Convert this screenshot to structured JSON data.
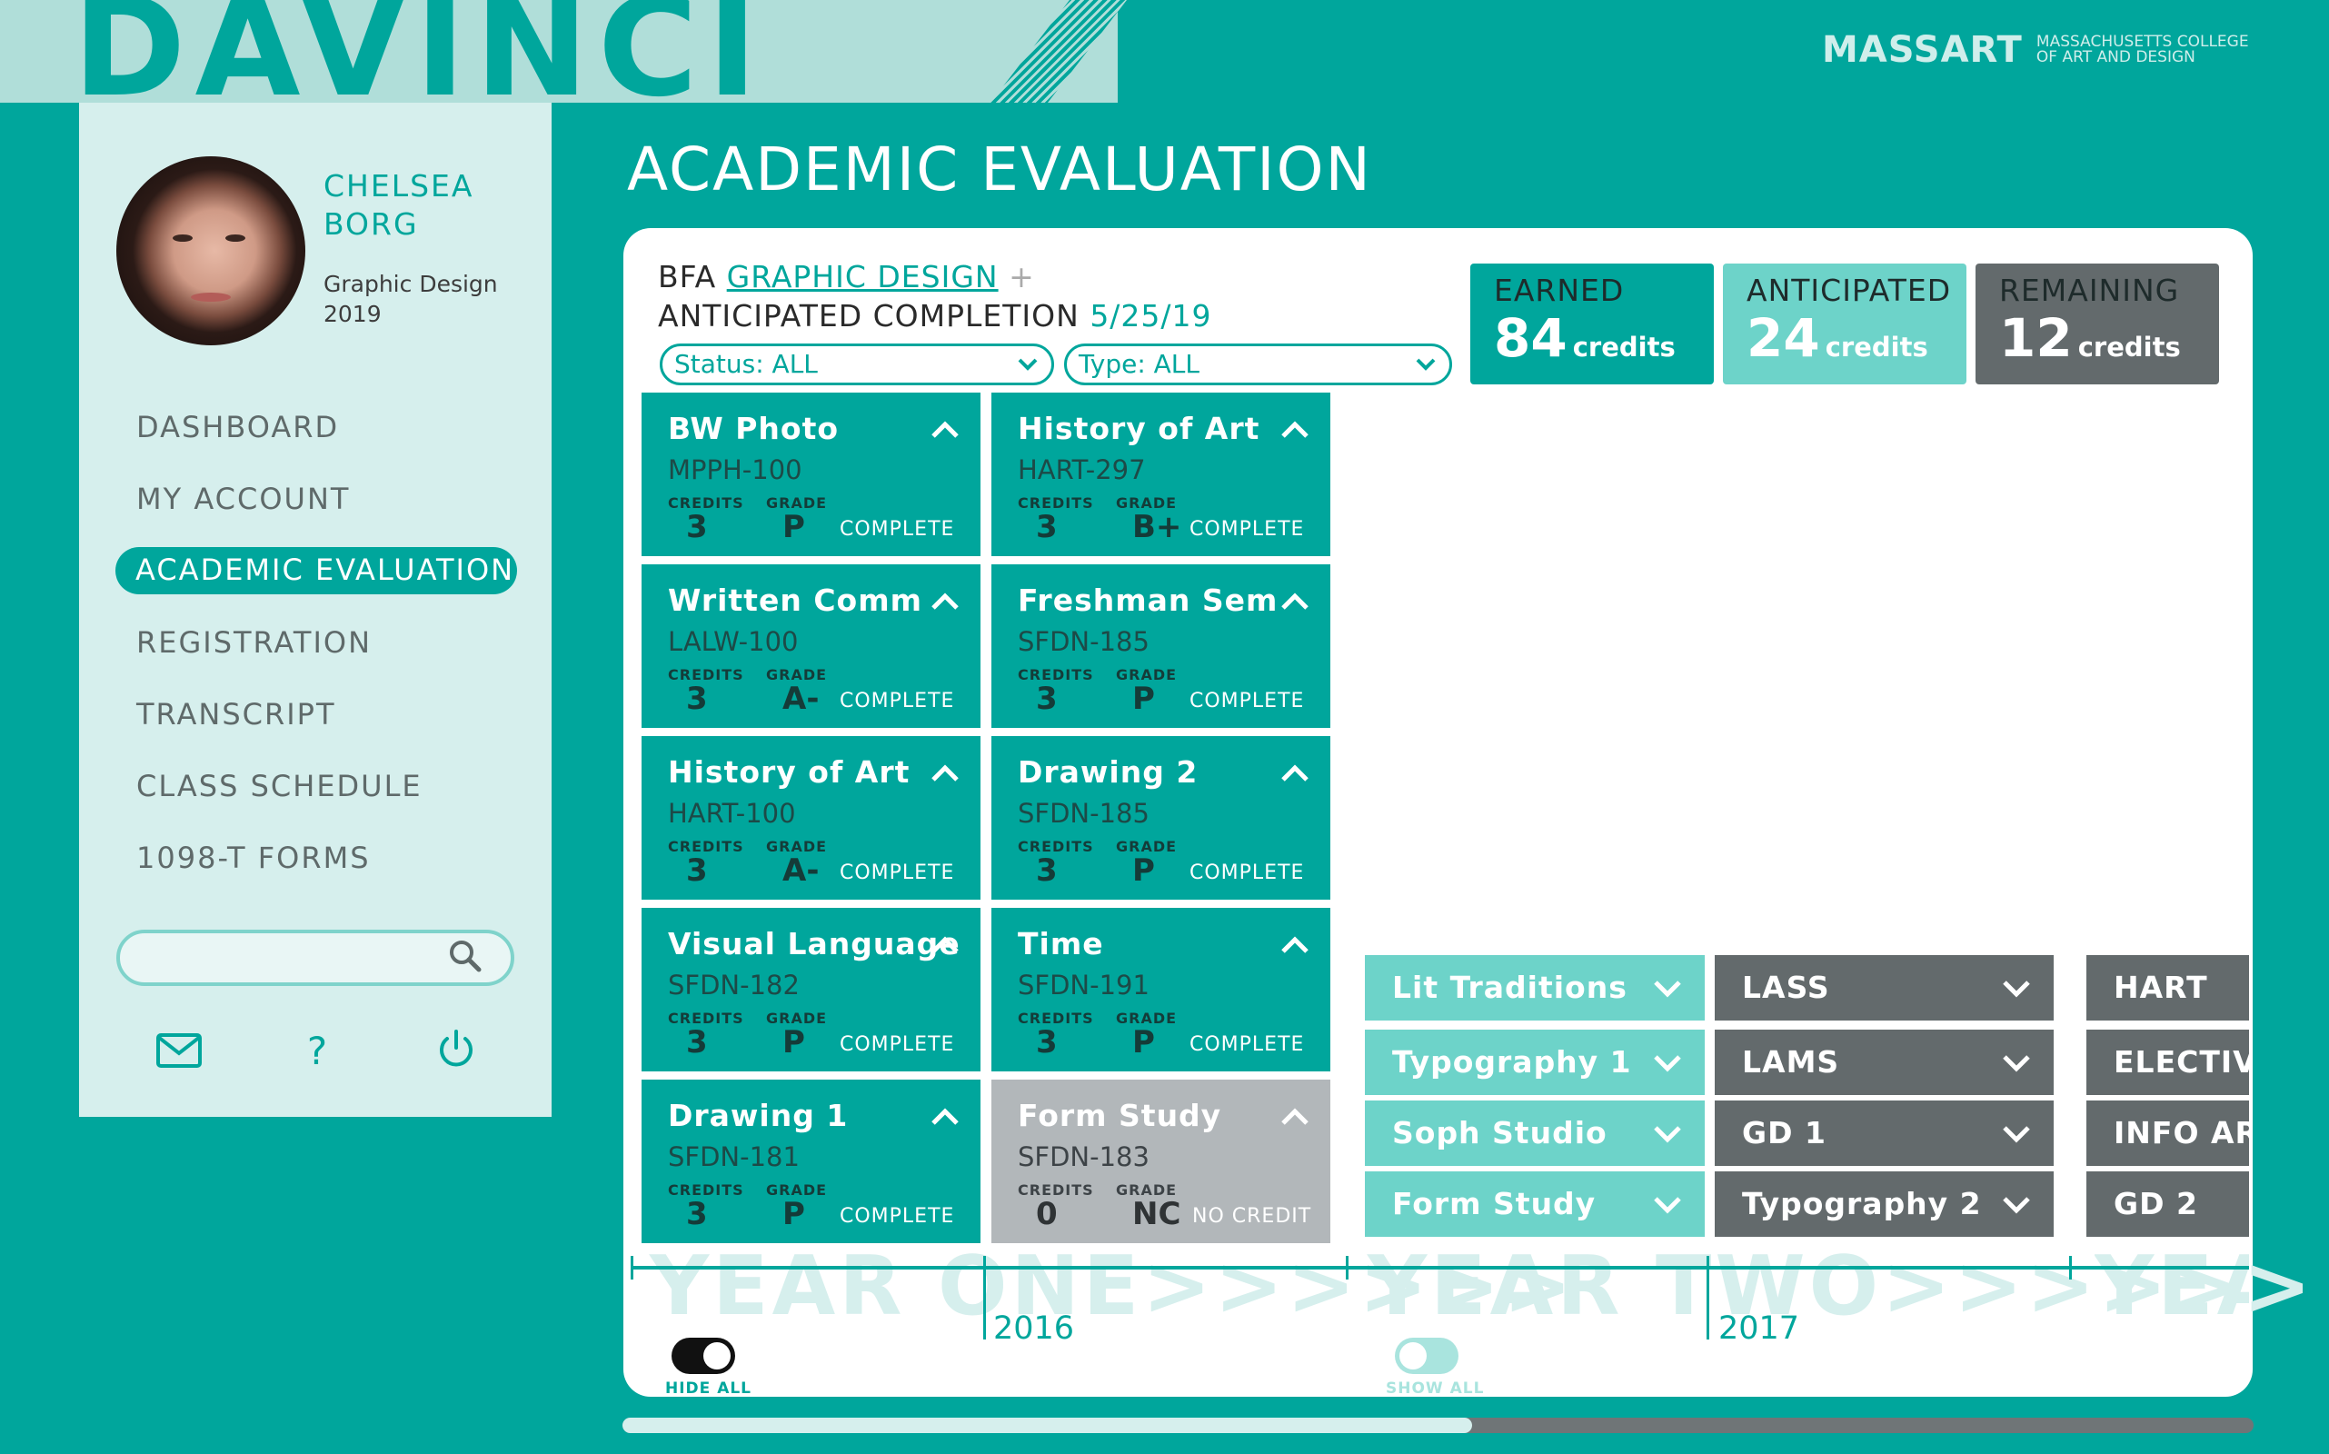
{
  "app": {
    "logo": "DAVINCI",
    "college_logo": "MASSART",
    "college_name_line1": "MASSACHUSETTS COLLEGE",
    "college_name_line2": "OF ART AND DESIGN"
  },
  "user": {
    "first": "CHELSEA",
    "last": "BORG",
    "program": "Graphic Design",
    "year": "2019"
  },
  "nav": {
    "items": [
      "DASHBOARD",
      "MY ACCOUNT",
      "ACADEMIC EVALUATION",
      "REGISTRATION",
      "TRANSCRIPT",
      "CLASS SCHEDULE",
      "1098-T FORMS"
    ],
    "active": "ACADEMIC EVALUATION"
  },
  "icons": {
    "mail": "mail-icon",
    "help": "help-icon",
    "power": "power-icon",
    "search": "search-icon"
  },
  "page": {
    "title": "ACADEMIC EVALUATION"
  },
  "degree": {
    "prefix": "BFA",
    "major": "GRAPHIC DESIGN",
    "plus": "+",
    "completion_label": "ANTICIPATED COMPLETION",
    "completion_date": "5/25/19"
  },
  "filters": {
    "status": "Status: ALL",
    "type": "Type: ALL"
  },
  "stats": [
    {
      "label": "EARNED",
      "value": "84",
      "unit": "credits",
      "color": "#00a69c"
    },
    {
      "label": "ANTICIPATED",
      "value": "24",
      "unit": "credits",
      "color": "#6dd3c9"
    },
    {
      "label": "REMAINING",
      "value": "12",
      "unit": "credits",
      "color": "#636a6c"
    }
  ],
  "course_labels": {
    "credits": "CREDITS",
    "grade": "GRADE"
  },
  "year_one_courses": [
    {
      "name": "BW Photo",
      "code": "MPPH-100",
      "credits": "3",
      "grade": "P",
      "status": "COMPLETE"
    },
    {
      "name": "History of Art",
      "code": "HART-297",
      "credits": "3",
      "grade": "B+",
      "status": "COMPLETE"
    },
    {
      "name": "Written Comm",
      "code": "LALW-100",
      "credits": "3",
      "grade": "A-",
      "status": "COMPLETE"
    },
    {
      "name": "Freshman Sem",
      "code": "SFDN-185",
      "credits": "3",
      "grade": "P",
      "status": "COMPLETE"
    },
    {
      "name": "History of Art",
      "code": "HART-100",
      "credits": "3",
      "grade": "A-",
      "status": "COMPLETE"
    },
    {
      "name": "Drawing 2",
      "code": "SFDN-185",
      "credits": "3",
      "grade": "P",
      "status": "COMPLETE"
    },
    {
      "name": "Visual Language",
      "code": "SFDN-182",
      "credits": "3",
      "grade": "P",
      "status": "COMPLETE"
    },
    {
      "name": "Time",
      "code": "SFDN-191",
      "credits": "3",
      "grade": "P",
      "status": "COMPLETE"
    },
    {
      "name": "Drawing 1",
      "code": "SFDN-181",
      "credits": "3",
      "grade": "P",
      "status": "COMPLETE"
    },
    {
      "name": "Form Study",
      "code": "SFDN-183",
      "credits": "0",
      "grade": "NC",
      "status": "NO CREDIT"
    }
  ],
  "year_two_courses": {
    "col1": [
      "Lit Traditions",
      "Typography 1",
      "Soph Studio",
      "Form Study"
    ],
    "col2": [
      "LASS",
      "LAMS",
      "GD 1",
      "Typography 2"
    ],
    "col3": [
      "HART",
      "ELECTIV",
      "INFO AR",
      "GD 2"
    ]
  },
  "timeline": {
    "year_one": "YEAR ONE>>>>>>",
    "year_two": "YEAR TWO>>>>>>",
    "year_three": "YEA",
    "y1": "2016",
    "y2": "2017"
  },
  "toggles": {
    "hide_all": "HIDE ALL",
    "show_all": "SHOW ALL"
  }
}
